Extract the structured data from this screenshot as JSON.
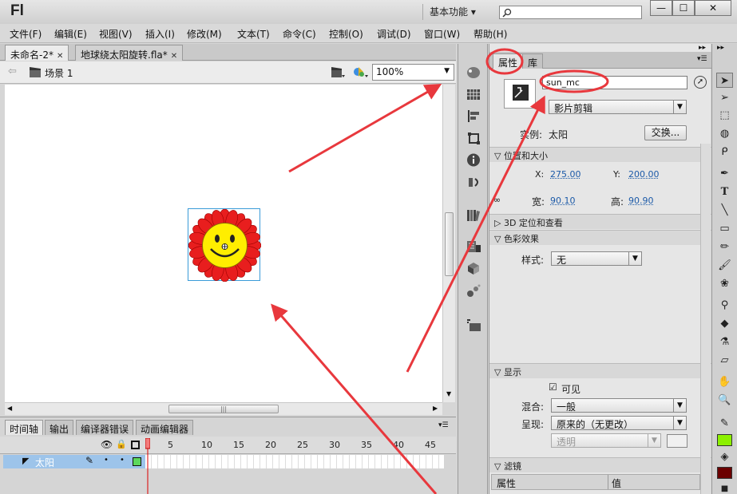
{
  "app": {
    "logo": "Fl",
    "workspace": "基本功能",
    "workspace_arrow": "▾"
  },
  "window_controls": {
    "minimize": "—",
    "maximize": "☐",
    "close": "✕"
  },
  "menu": [
    "文件(F)",
    "编辑(E)",
    "视图(V)",
    "插入(I)",
    "修改(M)",
    "文本(T)",
    "命令(C)",
    "控制(O)",
    "调试(D)",
    "窗口(W)",
    "帮助(H)"
  ],
  "doc_tabs": [
    {
      "label": "未命名-2*",
      "close": "✕"
    },
    {
      "label": "地球绕太阳旋转.fla*",
      "close": "✕"
    }
  ],
  "editbar": {
    "scene": "场景 1",
    "zoom": "100%"
  },
  "timeline": {
    "tabs": [
      "时间轴",
      "输出",
      "编译器错误",
      "动画编辑器"
    ],
    "frame_numbers": [
      "1",
      "5",
      "10",
      "15",
      "20",
      "25",
      "30",
      "35",
      "40",
      "45"
    ],
    "layer_name": "太阳"
  },
  "properties": {
    "tabs": [
      "属性",
      "库"
    ],
    "instance_name": "sun_mc",
    "instance_type": "影片剪辑",
    "instance_of_label": "实例:",
    "instance_of_value": "太阳",
    "swap_button": "交换...",
    "section_position": "位置和大小",
    "x_label": "X:",
    "x_value": "275.00",
    "y_label": "Y:",
    "y_value": "200.00",
    "w_label": "宽:",
    "w_value": "90.10",
    "h_label": "高:",
    "h_value": "90.90",
    "section_3d": "3D 定位和查看",
    "section_color": "色彩效果",
    "style_label": "样式:",
    "style_value": "无",
    "section_display": "显示",
    "visible_label": "可见",
    "visible_checked": "☑",
    "blend_label": "混合:",
    "blend_value": "一般",
    "render_label": "呈现:",
    "render_value": "原来的（无更改）",
    "transparent_value": "透明",
    "section_filters": "滤镜",
    "filter_col_prop": "属性",
    "filter_col_value": "值"
  },
  "colors": {
    "accent_red": "#e8383d",
    "fill_swatch": "#8cf000",
    "stroke_swatch": "#6b0000",
    "selection": "#9dc4ea"
  }
}
